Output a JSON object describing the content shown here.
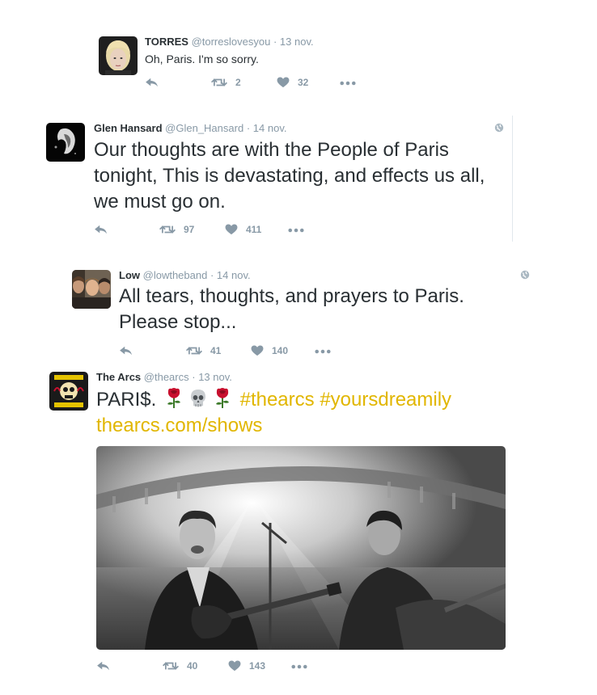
{
  "tweets": [
    {
      "name": "TORRES",
      "handle": "@torreslovesyou",
      "sep": "·",
      "date": "13 nov.",
      "text": "Oh, Paris. I'm so sorry.",
      "retweets": "2",
      "likes": "32"
    },
    {
      "name": "Glen Hansard",
      "handle": "@Glen_Hansard",
      "sep": "·",
      "date": "14 nov.",
      "text": "Our thoughts are with the People of Paris tonight, This is devastating, and effects us all, we must go on.",
      "retweets": "97",
      "likes": "411"
    },
    {
      "name": "Low",
      "handle": "@lowtheband",
      "sep": "·",
      "date": "14 nov.",
      "text": "All tears, thoughts, and prayers to Paris. Please stop...",
      "retweets": "41",
      "likes": "140"
    },
    {
      "name": "The Arcs",
      "handle": "@thearcs",
      "sep": "·",
      "date": "13 nov.",
      "text": "PARI$.",
      "hashtag1": "#thearcs",
      "hashtag2": "#yoursdreamily",
      "link": "thearcs.com/shows",
      "retweets": "40",
      "likes": "143"
    }
  ],
  "icons": {
    "reply": "reply-icon",
    "retweet": "retweet-icon",
    "like": "heart-icon",
    "more": "more-icon",
    "globe": "globe-icon",
    "rose": "rose-emoji",
    "skull": "skull-emoji"
  },
  "colors": {
    "text": "#292f33",
    "muted": "#8899a6",
    "hashtag": "#e1b600",
    "divider": "#e1e8ed"
  }
}
